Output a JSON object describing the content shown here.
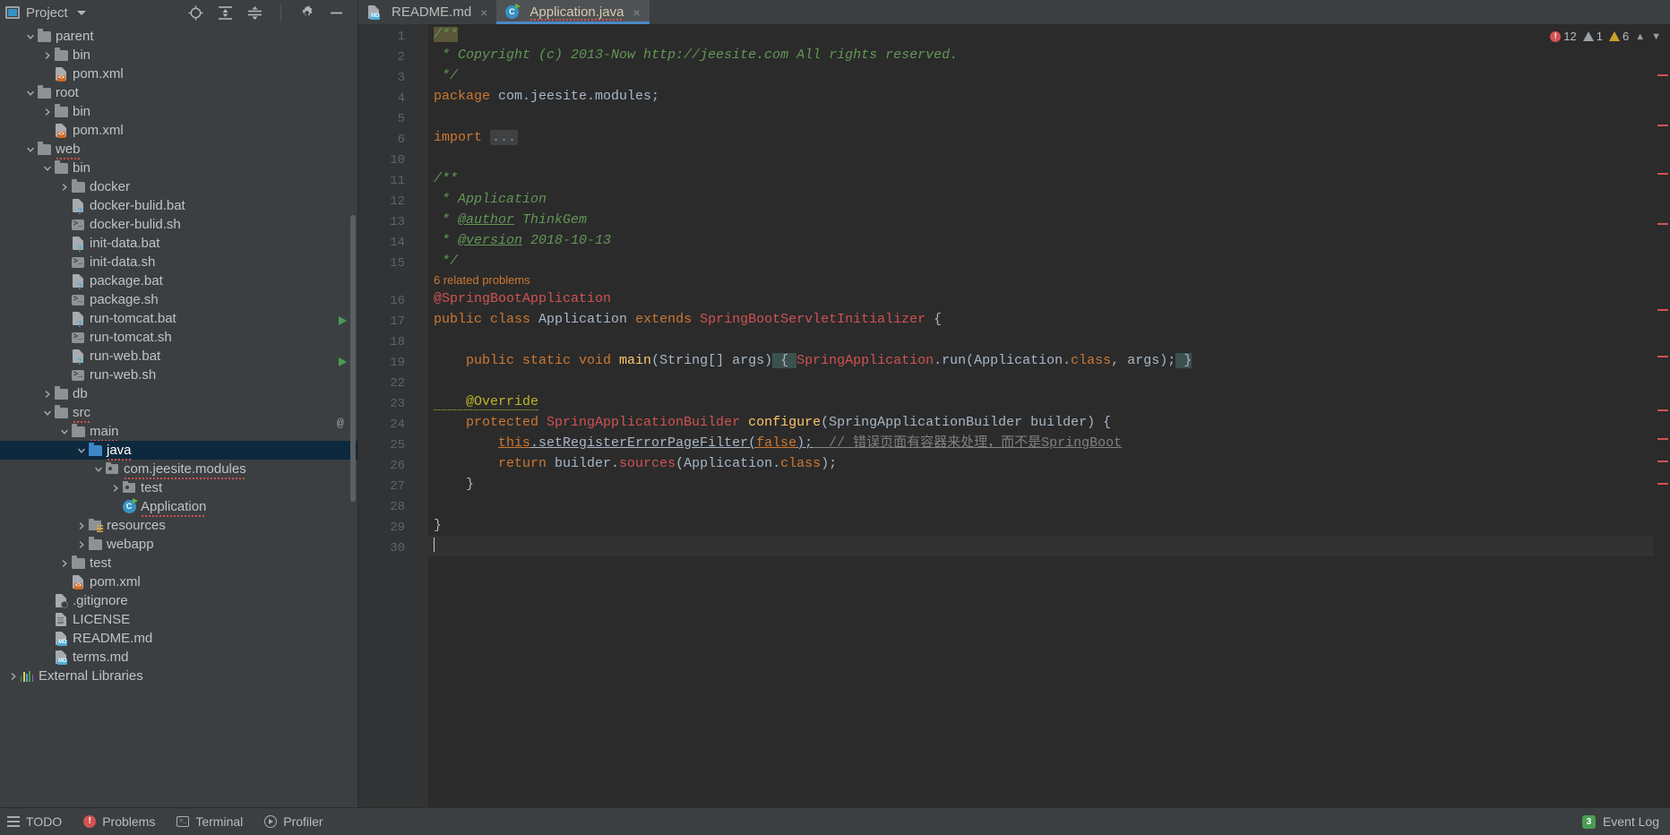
{
  "sidebar": {
    "title": "Project",
    "tools": [
      "locate-icon",
      "collapse-all-icon",
      "expand-icon",
      "settings-icon",
      "hide-icon"
    ],
    "tree": [
      {
        "label": "parent",
        "indent": 1,
        "arrow": "down",
        "icon": "folder"
      },
      {
        "label": "bin",
        "indent": 2,
        "arrow": "right",
        "icon": "folder"
      },
      {
        "label": "pom.xml",
        "indent": 2,
        "arrow": "none",
        "icon": "xml-file"
      },
      {
        "label": "root",
        "indent": 1,
        "arrow": "down",
        "icon": "folder"
      },
      {
        "label": "bin",
        "indent": 2,
        "arrow": "right",
        "icon": "folder"
      },
      {
        "label": "pom.xml",
        "indent": 2,
        "arrow": "none",
        "icon": "xml-file"
      },
      {
        "label": "web",
        "indent": 1,
        "arrow": "down",
        "icon": "folder",
        "squiggle": true
      },
      {
        "label": "bin",
        "indent": 2,
        "arrow": "down",
        "icon": "folder"
      },
      {
        "label": "docker",
        "indent": 3,
        "arrow": "right",
        "icon": "folder"
      },
      {
        "label": "docker-bulid.bat",
        "indent": 3,
        "arrow": "none",
        "icon": "bat-file"
      },
      {
        "label": "docker-bulid.sh",
        "indent": 3,
        "arrow": "none",
        "icon": "sh-file"
      },
      {
        "label": "init-data.bat",
        "indent": 3,
        "arrow": "none",
        "icon": "bat-file"
      },
      {
        "label": "init-data.sh",
        "indent": 3,
        "arrow": "none",
        "icon": "sh-file"
      },
      {
        "label": "package.bat",
        "indent": 3,
        "arrow": "none",
        "icon": "bat-file"
      },
      {
        "label": "package.sh",
        "indent": 3,
        "arrow": "none",
        "icon": "sh-file"
      },
      {
        "label": "run-tomcat.bat",
        "indent": 3,
        "arrow": "none",
        "icon": "bat-file"
      },
      {
        "label": "run-tomcat.sh",
        "indent": 3,
        "arrow": "none",
        "icon": "sh-file"
      },
      {
        "label": "run-web.bat",
        "indent": 3,
        "arrow": "none",
        "icon": "bat-file"
      },
      {
        "label": "run-web.sh",
        "indent": 3,
        "arrow": "none",
        "icon": "sh-file"
      },
      {
        "label": "db",
        "indent": 2,
        "arrow": "right",
        "icon": "folder"
      },
      {
        "label": "src",
        "indent": 2,
        "arrow": "down",
        "icon": "folder",
        "squiggle": true
      },
      {
        "label": "main",
        "indent": 3,
        "arrow": "down",
        "icon": "folder",
        "squiggle": true
      },
      {
        "label": "java",
        "indent": 4,
        "arrow": "down",
        "icon": "folder-blue",
        "selected": true,
        "squiggle": true
      },
      {
        "label": "com.jeesite.modules",
        "indent": 5,
        "arrow": "down",
        "icon": "package",
        "squiggle": true
      },
      {
        "label": "test",
        "indent": 6,
        "arrow": "right",
        "icon": "package"
      },
      {
        "label": "Application",
        "indent": 6,
        "arrow": "none",
        "icon": "java-class",
        "squiggle": true
      },
      {
        "label": "resources",
        "indent": 4,
        "arrow": "right",
        "icon": "resources-folder"
      },
      {
        "label": "webapp",
        "indent": 4,
        "arrow": "right",
        "icon": "folder"
      },
      {
        "label": "test",
        "indent": 3,
        "arrow": "right",
        "icon": "folder"
      },
      {
        "label": "pom.xml",
        "indent": 3,
        "arrow": "none",
        "icon": "xml-file"
      },
      {
        "label": ".gitignore",
        "indent": 2,
        "arrow": "none",
        "icon": "gitignore-file"
      },
      {
        "label": "LICENSE",
        "indent": 2,
        "arrow": "none",
        "icon": "text-file"
      },
      {
        "label": "README.md",
        "indent": 2,
        "arrow": "none",
        "icon": "md-file"
      },
      {
        "label": "terms.md",
        "indent": 2,
        "arrow": "none",
        "icon": "md-file"
      },
      {
        "label": "External Libraries",
        "indent": 0,
        "arrow": "right",
        "icon": "library"
      }
    ]
  },
  "tabs": [
    {
      "label": "README.md",
      "icon": "md-file",
      "active": false,
      "close": "×"
    },
    {
      "label": "Application.java",
      "icon": "java-class",
      "active": true,
      "close": "×"
    }
  ],
  "inspection": {
    "errors": "12",
    "warnings_gray": "1",
    "warnings": "6",
    "chevron_up": "⌃",
    "chevron_down": "⌄"
  },
  "editor": {
    "gutter_lines": [
      "1",
      "2",
      "3",
      "4",
      "5",
      "6",
      "10",
      "11",
      "12",
      "13",
      "14",
      "15",
      "16",
      "17",
      "18",
      "19",
      "22",
      "23",
      "24",
      "25",
      "26",
      "27",
      "28",
      "29",
      "30"
    ],
    "related_problems": "6 related problems",
    "code": {
      "l1": "/**",
      "l2": " * Copyright (c) 2013-Now http://jeesite.com All rights reserved.",
      "l3": " */",
      "l4_kw": "package",
      "l4_rest": " com.jeesite.modules;",
      "l6_kw": "import",
      "l6_fold": "...",
      "l11": "/**",
      "l12": " * Application",
      "l13_tag": "@author",
      "l13_val": " ThinkGem",
      "l13_pre": " * ",
      "l14_tag": "@version",
      "l14_val": " 2018-10-13",
      "l14_pre": " * ",
      "l15": " */",
      "l16": "@SpringBootApplication",
      "l17_a": "public class ",
      "l17_b": "Application",
      "l17_c": " extends ",
      "l17_d": "SpringBootServletInitializer",
      "l17_e": " {",
      "l19_a": "    public static void ",
      "l19_b": "main",
      "l19_c": "(String[] args)",
      "l19_d": " { ",
      "l19_e": "SpringApplication",
      "l19_f": ".run(Application.",
      "l19_g": "class",
      "l19_h": ", args);",
      "l19_i": " }",
      "l23": "    @Override",
      "l24_a": "    protected ",
      "l24_b": "SpringApplicationBuilder ",
      "l24_c": "configure",
      "l24_d": "(SpringApplicationBuilder builder) {",
      "l25_a": "        ",
      "l25_b": "this",
      "l25_c": ".setRegisterErrorPageFilter(",
      "l25_d": "false",
      "l25_e": ");",
      "l25_f": "  // 错误页面有容器来处理，而不是SpringBoot",
      "l26_a": "        ",
      "l26_b": "return",
      "l26_c": " builder.",
      "l26_d": "sources",
      "l26_e": "(Application.",
      "l26_f": "class",
      "l26_g": ");",
      "l27": "    }",
      "l29": "}"
    }
  },
  "statusbar": {
    "items": [
      {
        "label": "TODO",
        "icon": "todo-icon"
      },
      {
        "label": "Problems",
        "icon": "problems-icon"
      },
      {
        "label": "Terminal",
        "icon": "terminal-icon"
      },
      {
        "label": "Profiler",
        "icon": "profiler-icon"
      }
    ],
    "event_log": "Event Log",
    "event_count": "3"
  },
  "colors": {
    "accent": "#4a88c7",
    "selection": "#0d293e",
    "editor_bg": "#2b2b2b",
    "panel_bg": "#3c3f41",
    "error": "#d25252",
    "warning": "#c9a227"
  }
}
